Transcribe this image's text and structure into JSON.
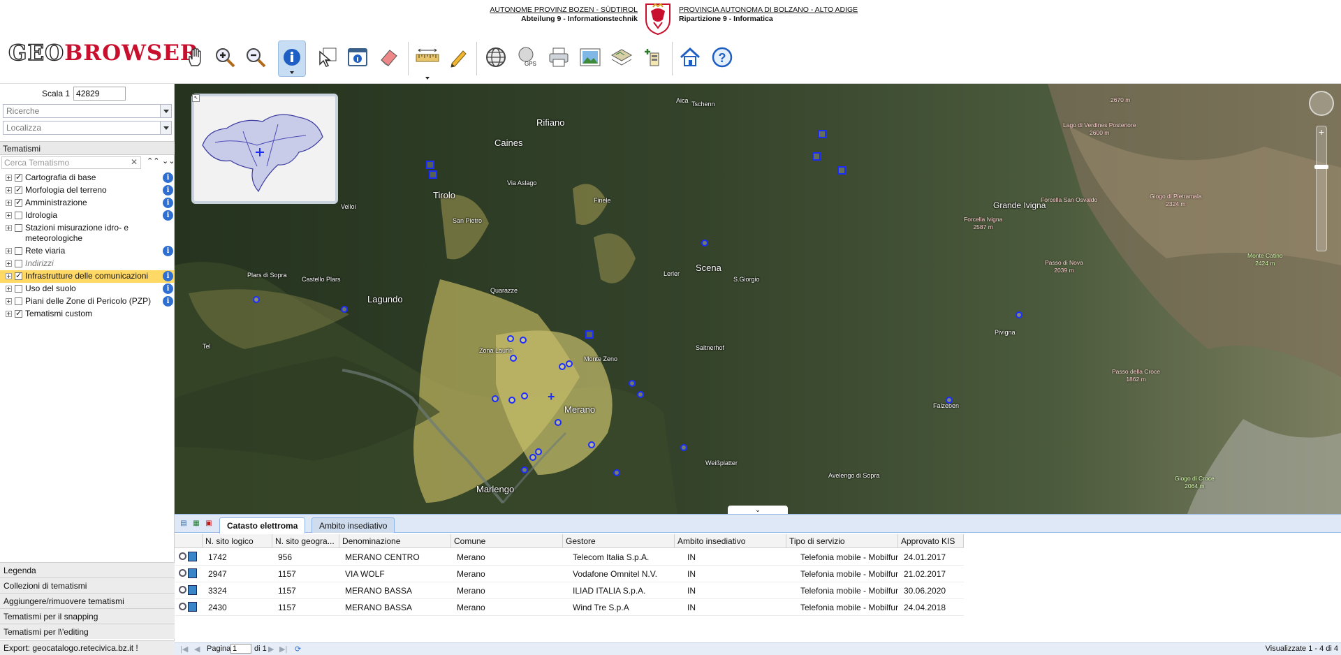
{
  "banner": {
    "left_line1": "AUTONOME PROVINZ BOZEN - SÜDTIROL",
    "left_line2": "Abteilung 9 - Informationstechnik",
    "right_line1": "PROVINCIA AUTONOMA DI BOLZANO - ALTO ADIGE",
    "right_line2": "Ripartizione 9 - Informatica"
  },
  "app": {
    "logo_geo": "GEO",
    "logo_browser": "BROWSER"
  },
  "toolbar": {
    "tools": [
      "pan-hand",
      "zoom-in",
      "zoom-out",
      "info",
      "select-arrow",
      "window-info",
      "eraser",
      "measure",
      "pencil",
      "globe",
      "gps",
      "print",
      "image",
      "map-layers",
      "add-layer",
      "home",
      "help"
    ],
    "active_tool": "info"
  },
  "sidebar": {
    "scale_label": "Scala 1",
    "scale_value": "42829",
    "search_placeholder": "Ricerche",
    "locate_placeholder": "Localizza",
    "themes_title": "Tematismi",
    "theme_search_placeholder": "Cerca Tematismo",
    "tree": [
      {
        "label": "Cartografia di base",
        "checked": true,
        "info": true
      },
      {
        "label": "Morfologia del terreno",
        "checked": true,
        "info": true
      },
      {
        "label": "Amministrazione",
        "checked": true,
        "info": true
      },
      {
        "label": "Idrologia",
        "checked": false,
        "info": true
      },
      {
        "label": "Stazioni misurazione idro- e meteorologiche",
        "checked": false,
        "info": false
      },
      {
        "label": "Rete viaria",
        "checked": false,
        "info": true
      },
      {
        "label": "Indirizzi",
        "checked": false,
        "info": false
      },
      {
        "label": "Infrastrutture delle comunicazioni",
        "checked": true,
        "info": true,
        "highlighted": true
      },
      {
        "label": "Uso del suolo",
        "checked": false,
        "info": true
      },
      {
        "label": "Piani delle Zone di Pericolo (PZP)",
        "checked": false,
        "info": true
      },
      {
        "label": "Tematismi custom",
        "checked": true,
        "info": false
      }
    ],
    "bottom_items": [
      "Legenda",
      "Collezioni di tematismi",
      "Aggiungere/rimuovere tematismi",
      "Tematismi per il snapping",
      "Tematismi per l\\'editing"
    ],
    "export_text": "Export: geocatalogo.retecivica.bz.it !"
  },
  "map": {
    "places": {
      "rifiano": "Rifiano",
      "caines": "Caines",
      "tirolo": "Tirolo",
      "scena": "Scena",
      "lagundo": "Lagundo",
      "merano": "Merano",
      "marlengo": "Marlengo",
      "aica": "Aica",
      "tschenn": "Tschenn",
      "via_aslago": "Via Aslago",
      "finele": "Finele",
      "san_pietro": "San Pietro",
      "velloi": "Velloi",
      "plars_di_sopra": "Plars di Sopra",
      "castello_plars": "Castello Plars",
      "quarazze": "Quarazze",
      "lerler": "Lerler",
      "s_giorgio": "S.Giorgio",
      "zona_laurin": "Zona Laurin",
      "monte_zeno": "Monte Zeno",
      "saltnerhof": "Saltnerhof",
      "tel": "Tel",
      "weissplatter": "Weißplatter",
      "avelengo_di_sopra": "Avelengo di Sopra",
      "falzeben": "Falzeben",
      "pivigna": "Pivigna",
      "grande_ivigna": "Grande Ivigna"
    },
    "peaks": {
      "p2670": "2670 m",
      "verdines": "Lago di Verdines Posteriore",
      "verdines_h": "2600 m",
      "san_osvaldo": "Forcella San Osvaldo",
      "pietramala": "Giogo di Pietramala",
      "pietramala_h": "2324 m",
      "ivigna": "Forcella Ivigna",
      "ivigna_h": "2587 m",
      "nova": "Passo di Nova",
      "nova_h": "2039 m",
      "catino": "Monte Catino",
      "catino_h": "2424 m",
      "croce": "Passo della Croce",
      "croce_h": "1862 m",
      "giogo_croce": "Giogo di Croce",
      "giogo_croce_h": "2064 m"
    }
  },
  "grid": {
    "tabs": [
      "Catasto elettroma",
      "Ambito insediativo"
    ],
    "active_tab": "Catasto elettroma",
    "columns": [
      "N. sito logico",
      "N. sito geogra...",
      "Denominazione",
      "Comune",
      "Gestore",
      "Ambito insediativo",
      "Tipo di servizio",
      "Approvato KIS"
    ],
    "rows": [
      [
        "1742",
        "956",
        "MERANO CENTRO",
        "Merano",
        "Telecom Italia S.p.A.",
        "IN",
        "Telefonia mobile - Mobilfunk",
        "24.01.2017"
      ],
      [
        "2947",
        "1157",
        "VIA WOLF",
        "Merano",
        "Vodafone Omnitel N.V.",
        "IN",
        "Telefonia mobile - Mobilfunk",
        "21.02.2017"
      ],
      [
        "3324",
        "1157",
        "MERANO BASSA",
        "Merano",
        "ILIAD ITALIA S.p.A.",
        "IN",
        "Telefonia mobile - Mobilfunk",
        "30.06.2020"
      ],
      [
        "2430",
        "1157",
        "MERANO BASSA",
        "Merano",
        "Wind Tre S.p.A",
        "IN",
        "Telefonia mobile - Mobilfunk",
        "24.04.2018"
      ]
    ]
  },
  "pager": {
    "page_label": "Pagina",
    "page_value": "1",
    "of_label": "di 1",
    "shown": "Visualizzate 1 - 4 di 4"
  },
  "colors": {
    "accent": "#c8102e",
    "active_tool": "#c7ddf3",
    "highlight": "#ffd966",
    "marker": "#1b2cff",
    "info_badge": "#2e6fd1"
  }
}
